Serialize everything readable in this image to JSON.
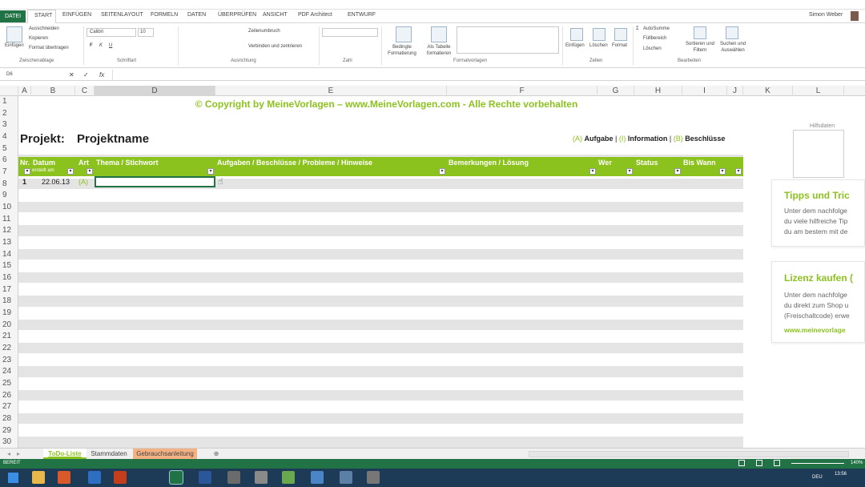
{
  "ribbon": {
    "tabs": [
      "DATEI",
      "START",
      "EINFÜGEN",
      "SEITENLAYOUT",
      "FORMELN",
      "DATEN",
      "ÜBERPRÜFEN",
      "ANSICHT",
      "PDF Architect",
      "ENTWURF"
    ],
    "user": "Simon Weber",
    "clipboard": {
      "paste": "Einfügen",
      "cut": "Ausschneiden",
      "copy": "Kopieren",
      "painter": "Format übertragen",
      "group": "Zwischenablage"
    },
    "font": {
      "name": "Calibri",
      "size": "10",
      "group": "Schriftart"
    },
    "alignment": {
      "wrap": "Zeilenumbruch",
      "merge": "Verbinden und zentrieren",
      "group": "Ausrichtung"
    },
    "number": {
      "group": "Zahl"
    },
    "styles": {
      "conditional": "Bedingte Formatierung",
      "as_table": "Als Tabelle formatieren",
      "group": "Formatvorlagen"
    },
    "cells": {
      "insert": "Einfügen",
      "delete": "Löschen",
      "format": "Format",
      "group": "Zellen"
    },
    "editing": {
      "autosum": "AutoSumme",
      "fill": "Füllbereich",
      "clear": "Löschen",
      "sort": "Sortieren und Filtern",
      "find": "Suchen und Auswählen",
      "group": "Bearbeiten"
    }
  },
  "formula_bar": {
    "namebox": "D6",
    "fx": "fx",
    "value": ""
  },
  "columns": [
    "A",
    "B",
    "C",
    "D",
    "E",
    "F",
    "G",
    "H",
    "I",
    "J",
    "K",
    "L"
  ],
  "rows": [
    "1",
    "2",
    "3",
    "4",
    "5",
    "6",
    "7",
    "8",
    "9",
    "10",
    "11",
    "12",
    "13",
    "14",
    "15",
    "16",
    "17",
    "18",
    "19",
    "20",
    "21",
    "22",
    "23",
    "24",
    "25",
    "26",
    "27",
    "28",
    "29",
    "30"
  ],
  "sheet": {
    "copyright": "© Copyright by MeineVorlagen – www.MeineVorlagen.com - Alle Rechte vorbehalten",
    "project_label": "Projekt:",
    "project_name": "Projektname",
    "legend": {
      "a": "(A)",
      "a_label": "Aufgabe",
      "sep": "|",
      "i": "(I)",
      "i_label": "Information",
      "b": "(B)",
      "b_label": "Beschlüsse"
    },
    "hilfe_label": "Hilfsdaten",
    "headers": {
      "nr": "Nr.",
      "datum": "Datum",
      "datum_sub": "erstellt am",
      "art": "Art",
      "thema": "Thema / Stichwort",
      "aufgaben": "Aufgaben / Beschlüsse / Probleme / Hinweise",
      "bemerkungen": "Bemerkungen / Lösung",
      "wer": "Wer",
      "status": "Status",
      "bis_wann": "Bis Wann"
    },
    "row1": {
      "nr": "1",
      "datum": "22.06.13",
      "art": "(A)"
    }
  },
  "cards": [
    {
      "title": "Tipps und Tric",
      "lines": [
        "Unter dem nachfolge",
        "du viele hilfreiche Tip",
        "du am bestem mit de"
      ]
    },
    {
      "title": "Lizenz kaufen (",
      "lines": [
        "Unter dem nachfolge",
        "du direkt zum Shop u",
        "(Freischaltcode) erwe"
      ],
      "link": "www.meinevorlage"
    }
  ],
  "sheet_tabs": [
    "ToDo-Liste",
    "Stammdaten",
    "Gebrauchsanleitung"
  ],
  "status": {
    "left": "BEREIT",
    "zoom": "140%"
  },
  "taskbar": {
    "lang": "DEU",
    "time": "13:56"
  },
  "colors": {
    "accent": "#8cc21e",
    "excel": "#217346",
    "band": "#e4e4e4",
    "orange": "#f4b183"
  }
}
